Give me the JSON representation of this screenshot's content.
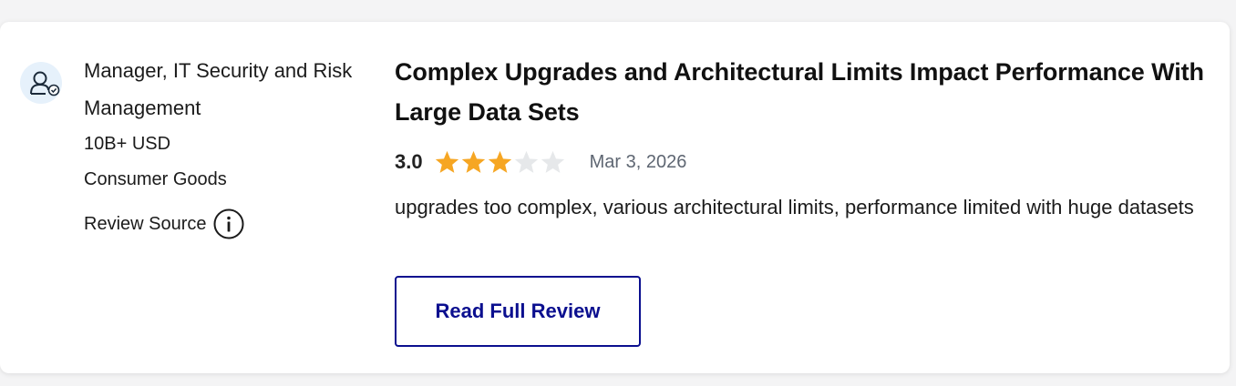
{
  "reviewer": {
    "role": "Manager, IT Security and Risk Management",
    "company_size": "10B+ USD",
    "industry": "Consumer Goods",
    "source_label": "Review Source",
    "avatar_icon": "verified-user-icon",
    "info_icon": "info-icon"
  },
  "review": {
    "title": "Complex Upgrades and Architectural Limits Impact Performance With Large Data Sets",
    "rating": "3.0",
    "rating_value": 3,
    "rating_max": 5,
    "date": "Mar 3, 2026",
    "summary": "upgrades too complex, various architectural limits, performance limited with huge datasets",
    "read_more_label": "Read Full Review"
  },
  "colors": {
    "star_filled": "#f6a623",
    "star_empty": "#e6e8ea",
    "button_accent": "#0b0f8f",
    "avatar_bg": "#e6f1fb"
  }
}
